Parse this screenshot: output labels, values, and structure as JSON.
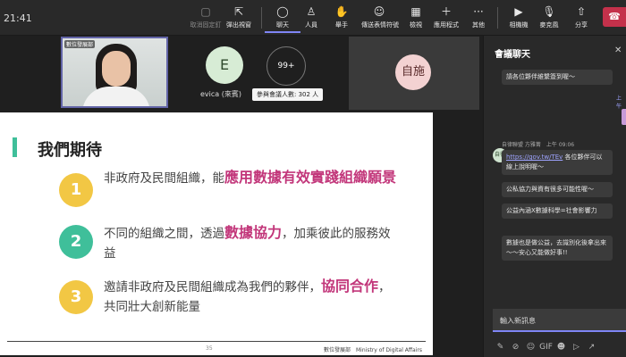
{
  "toolbar": {
    "clock": "21:41",
    "buttons": [
      {
        "name": "stop-camera",
        "label": "取消固定釘",
        "icon": "▢"
      },
      {
        "name": "pop-out",
        "label": "彈出視窗",
        "icon": "⇱"
      },
      {
        "name": "chat",
        "label": "聊天",
        "icon": "◯"
      },
      {
        "name": "people",
        "label": "人員",
        "icon": "♙"
      },
      {
        "name": "raise-hand",
        "label": "舉手",
        "icon": "✋"
      },
      {
        "name": "reactions",
        "label": "傳送表情符號",
        "icon": "☺"
      },
      {
        "name": "view",
        "label": "檢視",
        "icon": "▦"
      },
      {
        "name": "apps",
        "label": "應用程式",
        "icon": "＋"
      },
      {
        "name": "more",
        "label": "其他",
        "icon": "···"
      },
      {
        "name": "camera",
        "label": "相機機",
        "icon": "▶"
      },
      {
        "name": "mic",
        "label": "麥克風",
        "icon": "🎙"
      },
      {
        "name": "share",
        "label": "分享",
        "icon": "⇧"
      }
    ],
    "leave_icon": "☎"
  },
  "videos": {
    "speaker_tag": "數位發展部",
    "avatar_e": "E",
    "avatar_e_name": "evica (來賓)",
    "more_count": "99+",
    "participants_tooltip": "參與會議人數: 302 人",
    "avatar_right": "自施"
  },
  "slide": {
    "title": "我們期待",
    "points": [
      {
        "num": "1",
        "pre": "非政府及民間組織，能",
        "hl": "應用數據有效實踐組織願景",
        "post": ""
      },
      {
        "num": "2",
        "pre": "不同的組織之間，透過",
        "hl": "數據協力",
        "post": "，加乘彼此的服務效益"
      },
      {
        "num": "3",
        "pre": "邀請非政府及民間組織成為我們的夥伴，",
        "hl": "協同合作",
        "post": "，共同壯大創新能量"
      }
    ],
    "colors": {
      "p1": "#f2c744",
      "p2": "#3fbf9a",
      "p3": "#f2c744"
    },
    "page_number": "35",
    "org": "數位發展部　Ministry of Digital Affairs"
  },
  "chat": {
    "title": "會議聊天",
    "close_icon": "✕",
    "peek_label": "上午",
    "messages": [
      "請各位夥伴維繫簽到喔～",
      "公私協力與資有很多可能性喔～",
      "公益內涵X數據科學=社會影響力",
      "數據也是做公益，去識別化後拿出來～～安心又能做好事!!"
    ],
    "sender_line": "自律聯盟 方雅菁　上午 09:06",
    "sender_initials": "自律",
    "link_text": "https://gov.tw/TEv",
    "link_tail": " 各位夥伴可以線上說明喔～",
    "compose_placeholder": "輸入新訊息",
    "compose_tools": [
      "✎",
      "⊘",
      "☺",
      "GIF",
      "☻",
      "▷",
      "↗"
    ]
  }
}
